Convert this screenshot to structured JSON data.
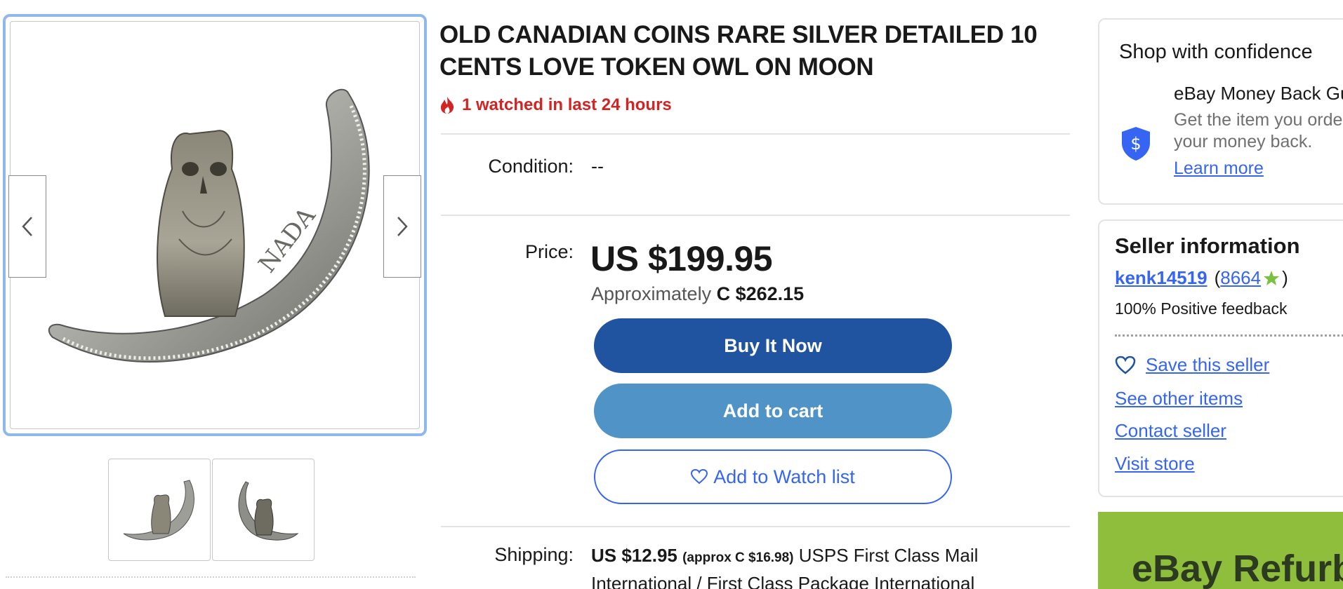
{
  "gallery": {
    "prev_label": "‹",
    "next_label": "›",
    "thumbnail_count": 2
  },
  "item": {
    "title": "OLD CANADIAN COINS RARE SILVER DETAILED 10 CENTS LOVE TOKEN OWL ON MOON",
    "watch_signal": "1 watched in last 24 hours"
  },
  "condition": {
    "label": "Condition:",
    "value": "--"
  },
  "price": {
    "label": "Price:",
    "value": "US $199.95",
    "approx_prefix": "Approximately",
    "approx_value": "C $262.15"
  },
  "actions": {
    "buy_now": "Buy It Now",
    "add_to_cart": "Add to cart",
    "add_to_watchlist": "Add to Watch list"
  },
  "shipping": {
    "label": "Shipping:",
    "price": "US $12.95",
    "approx": "(approx C $16.98)",
    "service_line1": "USPS First Class Mail",
    "service_line2": "International / First Class Package International"
  },
  "confidence": {
    "title": "Shop with confidence",
    "mbg_title": "eBay Money Back Guarantee",
    "mbg_desc_line1": "Get the item you ordered or get",
    "mbg_desc_line2": "your money back.",
    "learn_more": "Learn more"
  },
  "seller": {
    "title": "Seller information",
    "username": "kenk14519",
    "open_paren": "(",
    "score": "8664",
    "close_paren": ")",
    "feedback": "100% Positive feedback",
    "save_seller": "Save this seller",
    "see_other_items": "See other items",
    "contact_seller": "Contact seller",
    "visit_store": "Visit store"
  },
  "banner": {
    "text": "eBay Refurbished"
  },
  "colors": {
    "brand_blue": "#2154a0",
    "cart_blue": "#5094c7",
    "link_blue": "#3665f3",
    "alert_red": "#d32424",
    "banner_green": "#8ebe3c"
  }
}
